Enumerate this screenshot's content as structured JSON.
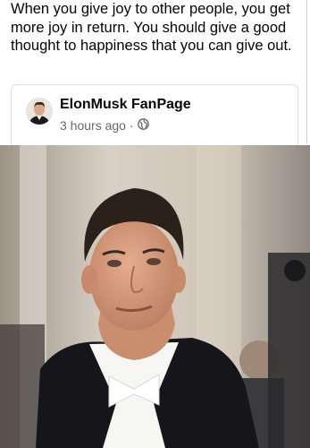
{
  "post": {
    "text": "When you give joy to other people, you get more joy in return. You should give a good thought to happiness that you can give out."
  },
  "shared_post": {
    "page_name": "ElonMusk FanPage",
    "timestamp": "3 hours ago",
    "separator": "·",
    "audience_icon": "globe-icon"
  },
  "colors": {
    "text": "#050505",
    "secondary_text": "#65676b",
    "card_border": "#dadde1"
  }
}
